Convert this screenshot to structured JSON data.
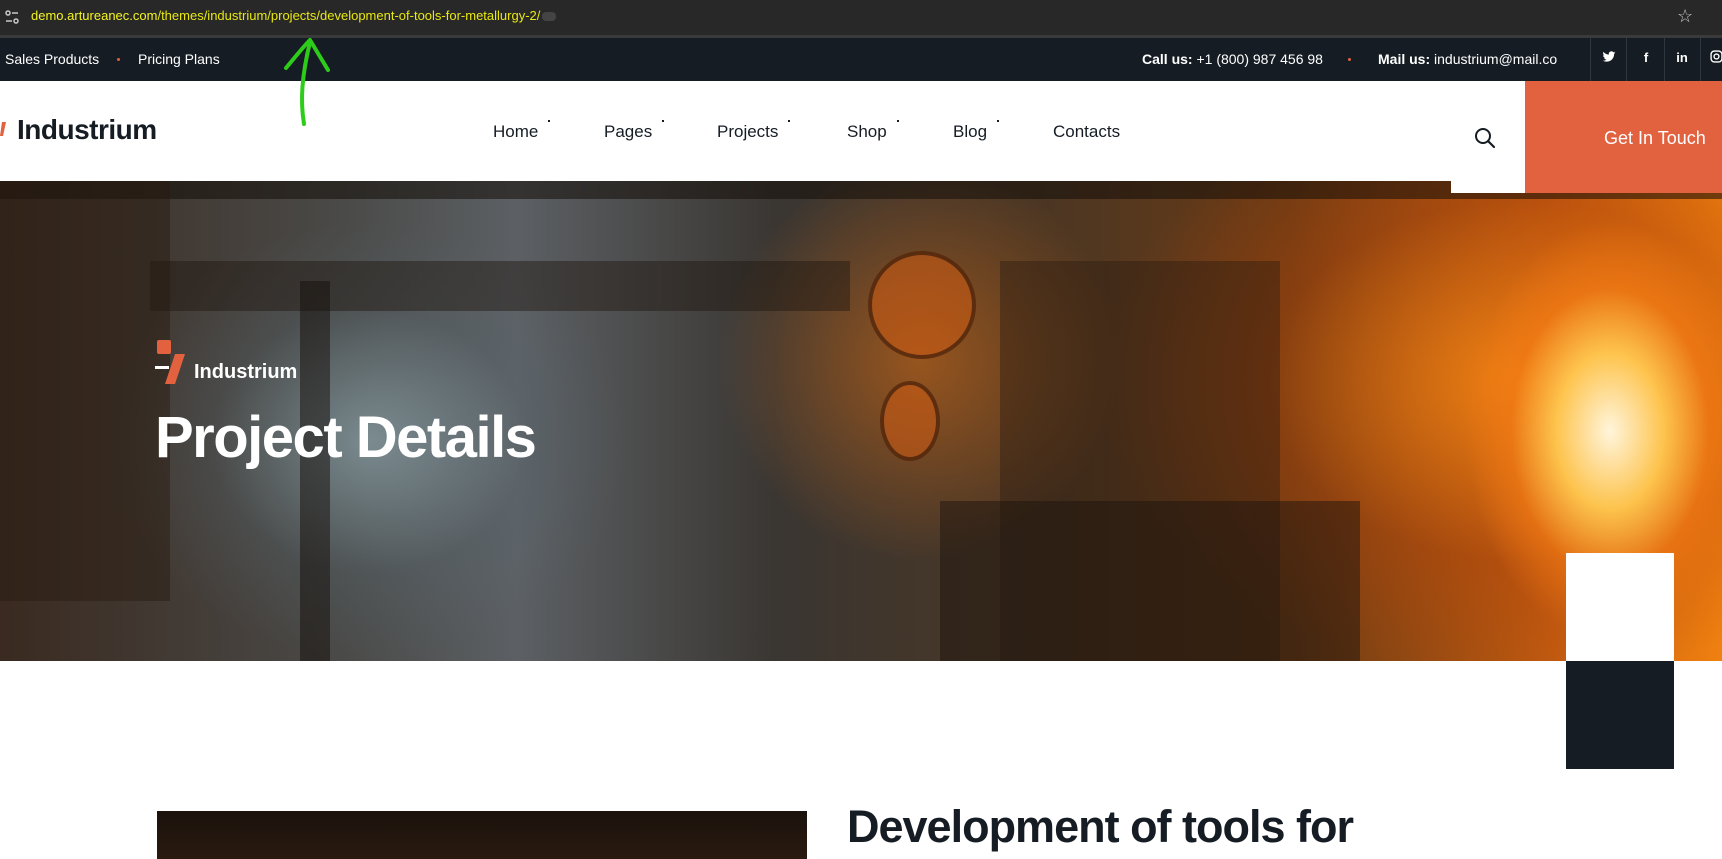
{
  "browser": {
    "url_host": "demo.artureanec.com",
    "url_path": "/themes/industrium/projects/development-of-tools-for-metallurgy-2/"
  },
  "topbar": {
    "links": [
      "Sales Products",
      "Pricing Plans"
    ],
    "call_label": "Call us:",
    "call_value": "+1 (800) 987 456 98",
    "mail_label": "Mail us:",
    "mail_value": "industrium@mail.co",
    "social": [
      "twitter-icon",
      "facebook-icon",
      "linkedin-icon",
      "instagram-icon"
    ]
  },
  "header": {
    "brand": "Industrium",
    "nav": [
      "Home",
      "Pages",
      "Projects",
      "Shop",
      "Blog",
      "Contacts"
    ],
    "cta": "Get In Touch"
  },
  "hero": {
    "subtitle": "Industrium",
    "title": "Project Details"
  },
  "content": {
    "title": "Development of tools for"
  },
  "colors": {
    "accent": "#e2613f",
    "dark": "#151c23",
    "annotation": "#2ecc1a"
  }
}
